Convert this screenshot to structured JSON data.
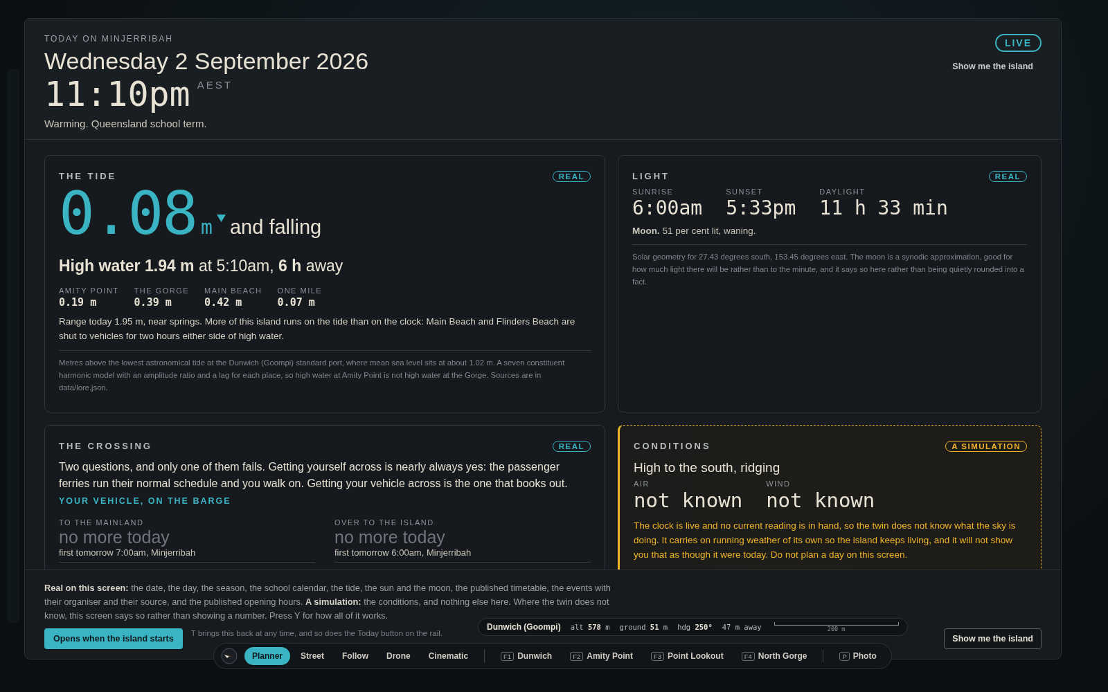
{
  "header": {
    "eyebrow": "TODAY ON MINJERRIBAH",
    "date": "Wednesday 2 September 2026",
    "time": "11:10pm",
    "timezone": "AEST",
    "note": "Warming. Queensland school term.",
    "live_badge": "LIVE",
    "link": "Show me the island"
  },
  "tide": {
    "title": "THE TIDE",
    "badge": {
      "label": "REAL",
      "kind": "real"
    },
    "reading": "0.08",
    "unit": "m",
    "falling": true,
    "trend": "and falling",
    "high_water": "**High water 1.94 m** at 5:10am, **6 h** away",
    "places": [
      {
        "name": "AMITY POINT",
        "value": "0.19 m"
      },
      {
        "name": "THE GORGE",
        "value": "0.39 m"
      },
      {
        "name": "MAIN BEACH",
        "value": "0.42 m"
      },
      {
        "name": "ONE MILE",
        "value": "0.07 m"
      }
    ],
    "summary": "Range today 1.95 m, near springs. More of this island runs on the tide than on the clock: Main Beach and Flinders Beach are shut to vehicles for two hours either side of high water.",
    "footnote": "Metres above the lowest astronomical tide at the Dunwich (Goompi) standard port, where mean sea level sits at about 1.02 m. A seven constituent harmonic model with an amplitude ratio and a lag for each place, so high water at Amity Point is not high water at the Gorge. Sources are in data/lore.json."
  },
  "light": {
    "title": "LIGHT",
    "badge": {
      "label": "REAL",
      "kind": "real"
    },
    "stats": [
      {
        "label": "SUNRISE",
        "value": "6:00am"
      },
      {
        "label": "SUNSET",
        "value": "5:33pm"
      },
      {
        "label": "DAYLIGHT",
        "value": "11 h 33 min"
      }
    ],
    "moon": "**Moon.** 51 per cent lit, waning.",
    "footnote": "Solar geometry for 27.43 degrees south, 153.45 degrees east. The moon is a synodic approximation, good for how much light there will be rather than to the minute, and it says so here rather than being quietly rounded into a fact."
  },
  "crossing": {
    "title": "THE CROSSING",
    "badge": {
      "label": "REAL",
      "kind": "real"
    },
    "intro": "Two questions, and only one of them fails. Getting yourself across is nearly always yes: the passenger ferries run their normal schedule and you walk on. Getting your vehicle across is the one that books out.",
    "subheading": "YOUR VEHICLE, ON THE BARGE",
    "directions": [
      {
        "label": "TO THE MAINLAND",
        "status": "no more today",
        "next": "first tomorrow 7:00am, Minjerribah"
      },
      {
        "label": "OVER TO THE ISLAND",
        "status": "no more today",
        "next": "first tomorrow 6:00am, Minjerribah"
      }
    ]
  },
  "conditions": {
    "title": "CONDITIONS",
    "badge": {
      "label": "A SIMULATION",
      "kind": "simulation"
    },
    "headline": "High to the south, ridging",
    "stats": [
      {
        "label": "AIR",
        "value": "not known"
      },
      {
        "label": "WIND",
        "value": "not known"
      }
    ],
    "warning": "The clock is live and no current reading is in hand, so the twin does not know what the sky is doing. It carries on running weather of its own so the island keeps living, and it will not show you that as though it were today. Do not plan a day on this screen."
  },
  "footer": {
    "text": "**Real on this screen:** the date, the day, the season, the school calendar, the tide, the sun and the moon, the published timetable, the events with their organiser and their source, and the published opening hours. **A simulation:** the conditions, and nothing else here. Where the twin does not know, this screen says so rather than showing a number. Press Y for how all of it works.",
    "button": "Opens when the island starts",
    "hint": "T brings this back at any time, and so does the Today button on the rail.",
    "right_button": "Show me the island"
  },
  "status_pill": {
    "place": "Dunwich (Goompi)",
    "readings": [
      "alt **578** m",
      "ground **51** m",
      "hdg **250°**",
      "47 m away"
    ],
    "scale": "200 m"
  },
  "nav": [
    {
      "kind": "mode",
      "label": "Planner",
      "selected": true
    },
    {
      "kind": "mode",
      "label": "Street",
      "selected": false
    },
    {
      "kind": "mode",
      "label": "Follow",
      "selected": false
    },
    {
      "kind": "mode",
      "label": "Drone",
      "selected": false
    },
    {
      "kind": "mode",
      "label": "Cinematic",
      "selected": false
    },
    {
      "kind": "place",
      "key": "F1",
      "label": "Dunwich",
      "selected": false
    },
    {
      "kind": "place",
      "key": "F2",
      "label": "Amity Point",
      "selected": false
    },
    {
      "kind": "place",
      "key": "F3",
      "label": "Point Lookout",
      "selected": false
    },
    {
      "kind": "place",
      "key": "F4",
      "label": "North Gorge",
      "selected": false
    },
    {
      "kind": "photo",
      "key": "P",
      "label": "Photo",
      "selected": false
    }
  ]
}
